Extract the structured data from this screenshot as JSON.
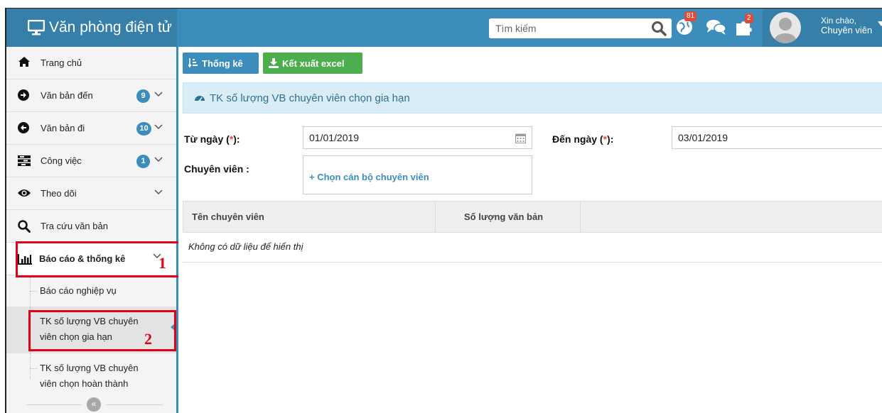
{
  "header": {
    "brand": "Văn phòng điện tử",
    "search_placeholder": "Tìm kiếm",
    "notifications_count": "81",
    "tasks_count": "2",
    "greeting": "Xin chào,",
    "user_name": "Chuyên viên",
    "accent_color": "#3c8dbc"
  },
  "sidebar": {
    "items": [
      {
        "label": "Trang chủ",
        "icon": "home-icon"
      },
      {
        "label": "Văn bản đến",
        "icon": "arrow-right-circle-icon",
        "badge": "9"
      },
      {
        "label": "Văn bản đi",
        "icon": "arrow-left-circle-icon",
        "badge": "10"
      },
      {
        "label": "Công việc",
        "icon": "tasks-icon",
        "badge": "1"
      },
      {
        "label": "Theo dõi",
        "icon": "eye-icon"
      },
      {
        "label": "Tra cứu văn bản",
        "icon": "search-icon"
      },
      {
        "label": "Báo cáo & thống kê",
        "icon": "bar-chart-icon"
      }
    ],
    "sub_items": [
      {
        "label": "Báo cáo nghiệp vụ"
      },
      {
        "label_line1": "TK số lượng VB chuyên",
        "label_line2": "viên chọn gia hạn"
      },
      {
        "label_line1": "TK số lượng VB chuyên",
        "label_line2": "viên chọn hoàn thành"
      }
    ],
    "annotation_1": "1",
    "annotation_2": "2",
    "collapse": "«"
  },
  "toolbar": {
    "stats_label": "Thống kê",
    "export_label": "Kết xuất excel"
  },
  "panel": {
    "title": "TK số lượng VB chuyên viên chọn gia hạn"
  },
  "form": {
    "from_label": "Từ ngày (",
    "req_mark": "*",
    "label_close": "):",
    "from_value": "01/01/2019",
    "to_label": "Đến ngày (",
    "to_value": "03/01/2019",
    "officer_label": "Chuyên viên :",
    "officer_picker": "+ Chọn cán bộ chuyên viên"
  },
  "table": {
    "columns": [
      "Tên chuyên viên",
      "Số lượng văn bản"
    ],
    "empty_message": "Không có dữ liệu để hiển thị"
  }
}
